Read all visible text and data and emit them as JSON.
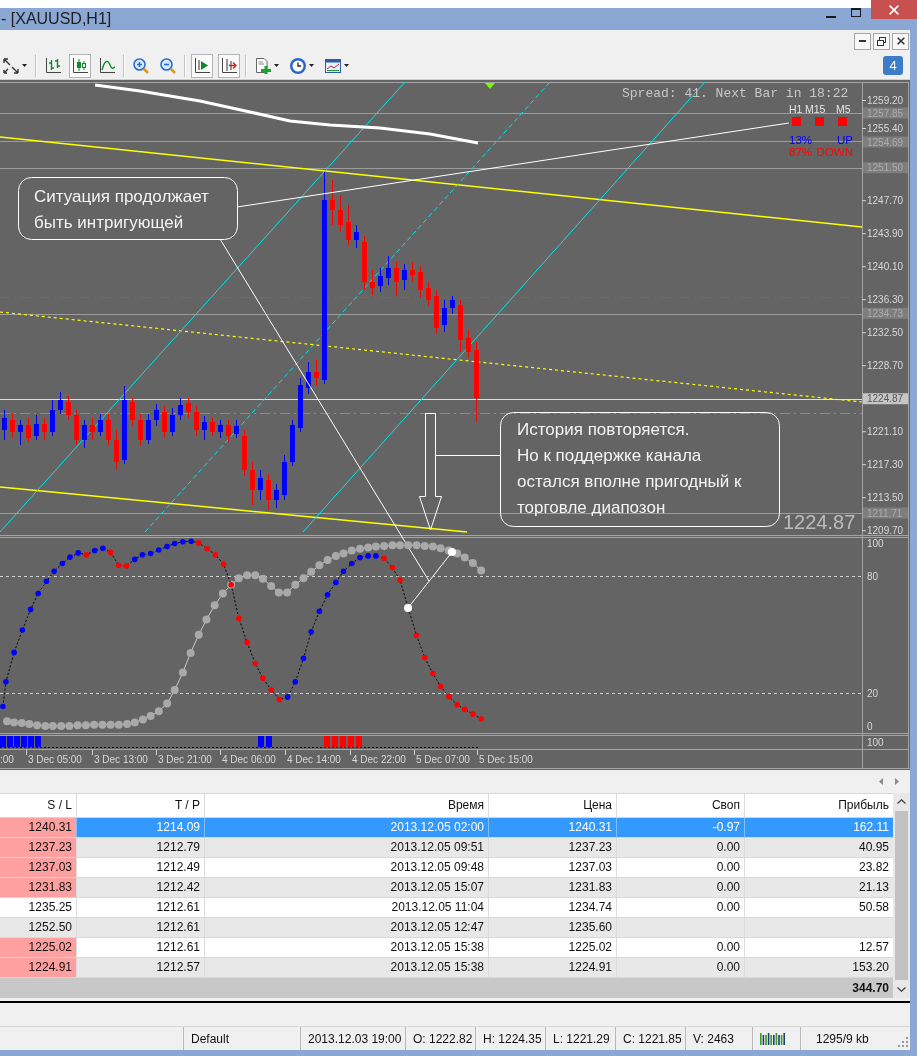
{
  "window": {
    "title": "- [XAUUSD,H1]"
  },
  "toolbar": [
    {
      "kind": "arrows",
      "menu": true,
      "pressed": false
    },
    {
      "kind": "separator"
    },
    {
      "kind": "bars",
      "pressed": false
    },
    {
      "kind": "candles",
      "pressed": true
    },
    {
      "kind": "line",
      "pressed": false
    },
    {
      "kind": "separator"
    },
    {
      "kind": "zoomin",
      "pressed": false
    },
    {
      "kind": "zoomout",
      "pressed": false
    },
    {
      "kind": "separator"
    },
    {
      "kind": "shift",
      "pressed": true
    },
    {
      "kind": "autoscroll",
      "pressed": true
    },
    {
      "kind": "separator"
    },
    {
      "kind": "indicators",
      "menu": true,
      "pressed": false
    },
    {
      "kind": "periods",
      "menu": true,
      "pressed": false
    },
    {
      "kind": "templates",
      "menu": true,
      "pressed": false
    }
  ],
  "messages": {
    "count": "4"
  },
  "chart": {
    "info": "Spread: 41. Next Bar in 18:22",
    "timeframes": [
      {
        "label": "H1",
        "color": "#ff0000"
      },
      {
        "label": "M15",
        "color": "#ff0000"
      },
      {
        "label": "M5",
        "color": "#ff0000"
      }
    ],
    "signals": [
      {
        "percent": "13%",
        "direction": "UP",
        "color": "#0000ff"
      },
      {
        "percent": "87%",
        "direction": "DOWN",
        "color": "#ff0000"
      }
    ],
    "callouts": [
      {
        "lines": [
          "Ситуация продолжает",
          "быть интригующей"
        ]
      },
      {
        "lines": [
          "История повторяется.",
          "Но к поддержке канала",
          "остался вполне пригодный к",
          "торговле диапозон"
        ]
      }
    ],
    "last_price": "1224.87",
    "price_axis": [
      {
        "text": "1259.20",
        "kind": "tick"
      },
      {
        "text": "1257.85",
        "kind": "level"
      },
      {
        "text": "1255.40",
        "kind": "tick"
      },
      {
        "text": "1254.69",
        "kind": "level"
      },
      {
        "text": "1251.50",
        "kind": "level"
      },
      {
        "text": "1247.70",
        "kind": "tick"
      },
      {
        "text": "1243.90",
        "kind": "tick"
      },
      {
        "text": "1240.10",
        "kind": "tick"
      },
      {
        "text": "1236.30",
        "kind": "tick"
      },
      {
        "text": "1234.73",
        "kind": "level"
      },
      {
        "text": "1232.50",
        "kind": "tick"
      },
      {
        "text": "1228.70",
        "kind": "tick"
      },
      {
        "text": "1224.87",
        "kind": "bid"
      },
      {
        "text": "1221.10",
        "kind": "tick"
      },
      {
        "text": "1217.30",
        "kind": "tick"
      },
      {
        "text": "1213.50",
        "kind": "tick"
      },
      {
        "text": "1211.71",
        "kind": "level"
      },
      {
        "text": "1209.70",
        "kind": "tick"
      }
    ],
    "oscillator_axis": [
      "100",
      "80",
      "20",
      "0"
    ],
    "histogram_axis": [
      "100"
    ],
    "time_axis": [
      ":00",
      "3 Dec 05:00",
      "3 Dec 13:00",
      "3 Dec 21:00",
      "4 Dec 06:00",
      "4 Dec 14:00",
      "4 Dec 22:00",
      "5 Dec 07:00",
      "5 Dec 15:00"
    ]
  },
  "table": {
    "columns": [
      "S / L",
      "T / P",
      "Время",
      "Цена",
      "Своп",
      "Прибыль"
    ],
    "rows": [
      {
        "sl": "1240.31",
        "tp": "1214.09",
        "time": "2013.12.05 02:00",
        "price": "1240.31",
        "swap": "-0.97",
        "profit": "162.11",
        "selected": true,
        "sl_highlighted": true
      },
      {
        "sl": "1237.23",
        "tp": "1212.79",
        "time": "2013.12.05 09:51",
        "price": "1237.23",
        "swap": "0.00",
        "profit": "40.95",
        "selected": false,
        "sl_highlighted": true
      },
      {
        "sl": "1237.03",
        "tp": "1212.49",
        "time": "2013.12.05 09:48",
        "price": "1237.03",
        "swap": "0.00",
        "profit": "23.82",
        "selected": false,
        "sl_highlighted": true
      },
      {
        "sl": "1231.83",
        "tp": "1212.42",
        "time": "2013.12.05 15:07",
        "price": "1231.83",
        "swap": "0.00",
        "profit": "21.13",
        "selected": false,
        "sl_highlighted": true
      },
      {
        "sl": "1235.25",
        "tp": "1212.61",
        "time": "2013.12.05 11:04",
        "price": "1234.74",
        "swap": "0.00",
        "profit": "50.58",
        "selected": false,
        "sl_highlighted": false
      },
      {
        "sl": "1252.50",
        "tp": "1212.61",
        "time": "2013.12.05 12:47",
        "price": "1235.60",
        "selected": false,
        "sl_highlighted": false
      },
      {
        "sl": "1225.02",
        "tp": "1212.61",
        "time": "2013.12.05 15:38",
        "price": "1225.02",
        "swap": "0.00",
        "profit": "12.57",
        "selected": false,
        "sl_highlighted": true
      },
      {
        "sl": "1224.91",
        "tp": "1212.57",
        "time": "2013.12.05 15:38",
        "price": "1224.91",
        "swap": "0.00",
        "profit": "153.20",
        "selected": false,
        "sl_highlighted": true
      }
    ],
    "total": {
      "profit": "344.70"
    }
  },
  "status_bar": {
    "profile": "Default",
    "time": "2013.12.03 19:00",
    "open": "O: 1222.82",
    "high": "H: 1224.35",
    "low": "L: 1221.29",
    "close": "C: 1221.85",
    "volume": "V: 2463",
    "traffic": "1295/9 kb"
  }
}
